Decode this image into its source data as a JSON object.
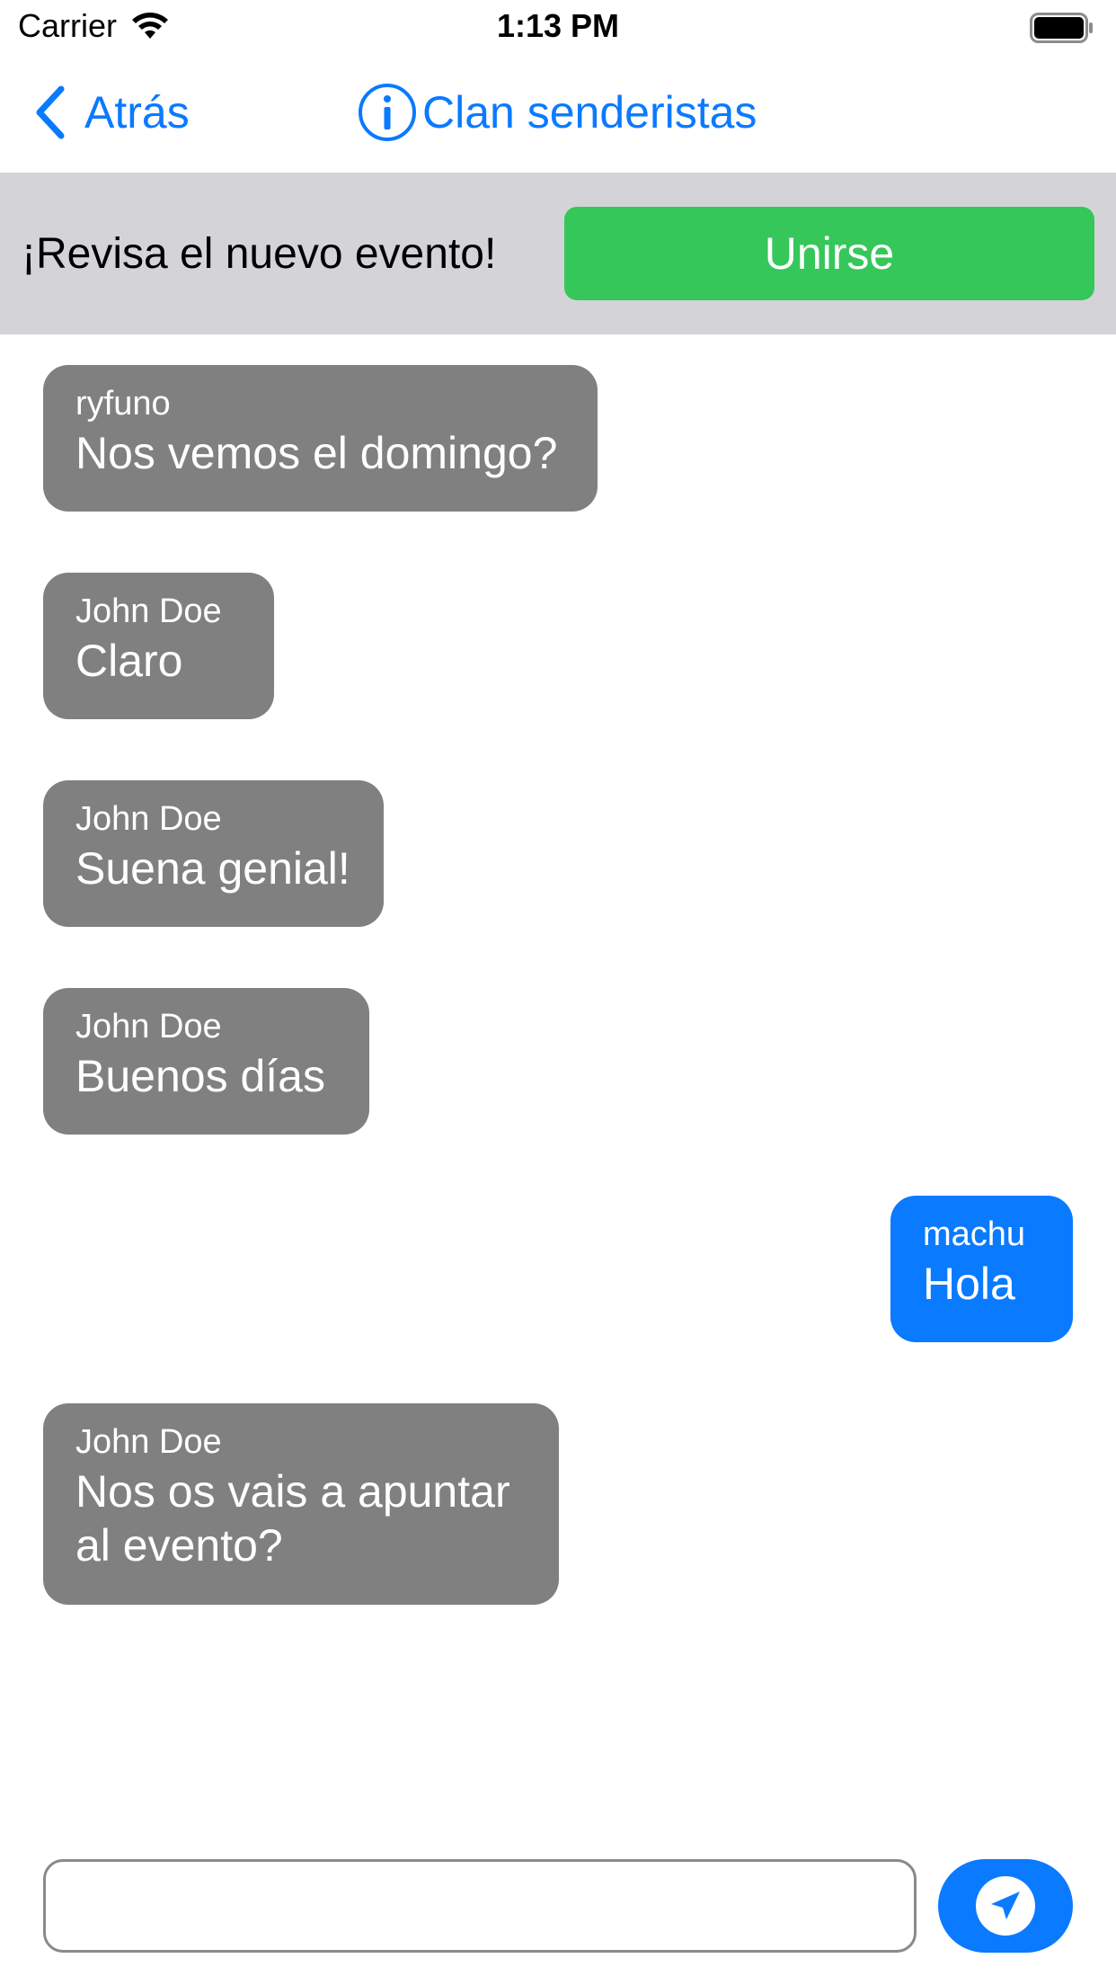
{
  "status_bar": {
    "carrier": "Carrier",
    "time": "1:13 PM",
    "icons": [
      "wifi-icon",
      "battery-icon"
    ]
  },
  "nav": {
    "back_label": "Atrás",
    "title": "Clan senderistas",
    "icons": [
      "chevron-left-icon",
      "info-icon"
    ]
  },
  "banner": {
    "text": "¡Revisa el nuevo evento!",
    "button_label": "Unirse"
  },
  "messages": [
    {
      "sender": "ryfuno",
      "text": "Nos vemos el domingo?",
      "direction": "incoming"
    },
    {
      "sender": "John Doe",
      "text": "Claro",
      "direction": "incoming"
    },
    {
      "sender": "John Doe",
      "text": "Suena genial!",
      "direction": "incoming"
    },
    {
      "sender": "John Doe",
      "text": "Buenos días",
      "direction": "incoming"
    },
    {
      "sender": "machu",
      "text": "Hola",
      "direction": "outgoing"
    },
    {
      "sender": "John Doe",
      "text": "Nos os vais a apuntar\nal evento?",
      "direction": "incoming"
    }
  ],
  "composer": {
    "placeholder": "",
    "send_icon": "send-icon"
  },
  "colors": {
    "accent": "#0a7aff",
    "join_green": "#35c759",
    "incoming_bubble": "#808080",
    "banner_bg": "#d4d4d8"
  }
}
